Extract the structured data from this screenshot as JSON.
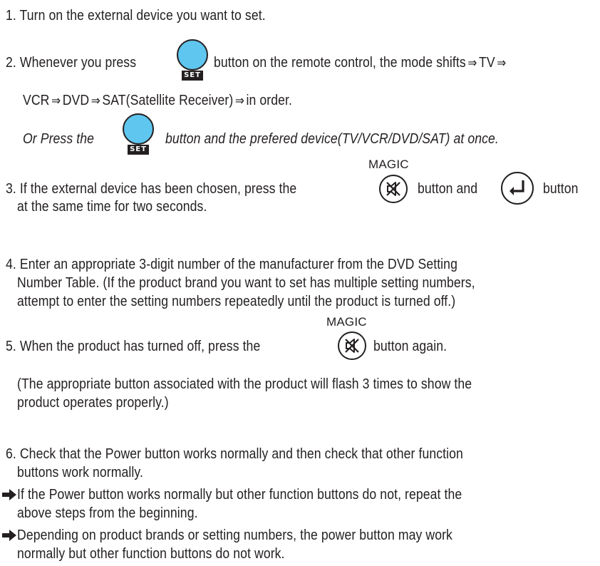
{
  "steps": {
    "s1": "1. Turn on the external device you want to set.",
    "s2_a": "2. Whenever you press",
    "s2_b": "button on the remote control, the mode shifts",
    "s2_tv": "TV",
    "s2_line2_vcr": "VCR",
    "s2_line2_dvd": "DVD",
    "s2_line2_sat": "SAT(Satellite Receiver)",
    "s2_line2_end": "in order.",
    "or_a": "Or Press the",
    "or_b": "button and the prefered device(TV/VCR/DVD/SAT) at once.",
    "s3_a": "3. If the external device has been chosen, press the",
    "s3_b": "button and",
    "s3_c": "button",
    "s3_line2": "at the same time for two seconds.",
    "s4_line1": "4. Enter an appropriate 3-digit number of the manufacturer from the DVD Setting",
    "s4_line2": "Number Table. (If the product brand you want to set has multiple setting numbers,",
    "s4_line3": "attempt to enter the setting numbers repeatedly until the product is turned off.)",
    "s5_a": "5. When the product has turned off, press the",
    "s5_b": "button again.",
    "note_line1": "(The appropriate button associated with the product will flash 3 times to show the",
    "note_line2": "product operates properly.)",
    "s6_line1": "6. Check that the Power button works normally and then check that other function",
    "s6_line2": "buttons work normally.",
    "b1_line1": "If the Power button works normally but other function buttons do not, repeat the",
    "b1_line2": "above steps from the beginning.",
    "b2_line1": "Depending on product brands or setting numbers, the power button may work",
    "b2_line2": "normally but other function buttons do not work."
  },
  "buttons": {
    "set_label": "SET",
    "magic_label": "MAGIC"
  },
  "icons": {
    "mode_arrow": "double-arrow-icon",
    "mute": "mute-icon",
    "enter": "enter-icon",
    "bullet": "right-arrow-bullet-icon"
  },
  "colors": {
    "set_button": "#5ec6ef",
    "text": "#231f20"
  }
}
